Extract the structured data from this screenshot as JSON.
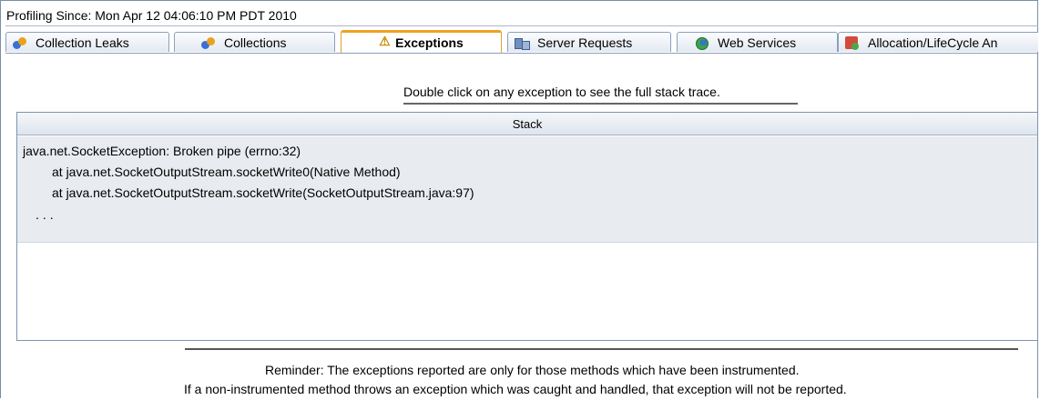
{
  "header": {
    "profiling_since": "Profiling Since: Mon Apr 12 04:06:10 PM PDT 2010"
  },
  "tabs": [
    {
      "label": "Collection Leaks",
      "icon": "people-icon"
    },
    {
      "label": "Collections",
      "icon": "people-icon"
    },
    {
      "label": "Exceptions",
      "icon": "warning-icon",
      "active": true
    },
    {
      "label": "Server Requests",
      "icon": "server-icon"
    },
    {
      "label": "Web Services",
      "icon": "web-services-icon"
    },
    {
      "label": "Allocation/LifeCycle An",
      "icon": "allocation-icon"
    }
  ],
  "instruction": "Double click on any exception to see the full stack trace.",
  "table": {
    "column_header": "Stack",
    "rows": [
      {
        "lines": [
          "java.net.SocketException: Broken pipe (errno:32)",
          "at java.net.SocketOutputStream.socketWrite0(Native Method)",
          "at java.net.SocketOutputStream.socketWrite(SocketOutputStream.java:97)",
          "..."
        ]
      }
    ]
  },
  "reminder": {
    "line1": "Reminder: The exceptions reported are only for those methods which have been instrumented.",
    "line2": "If a non-instrumented method throws an exception which was caught and handled, that exception will not be reported."
  },
  "colors": {
    "active_tab_accent": "#f0a020",
    "row_background": "#e8ecf1",
    "tab_border": "#8aa0bb"
  }
}
